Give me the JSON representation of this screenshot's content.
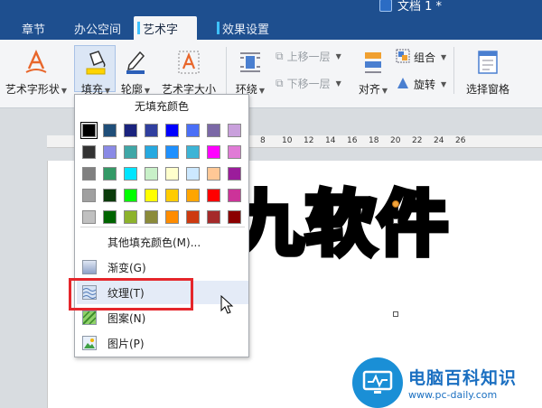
{
  "window": {
    "title": "文档 1 *"
  },
  "tabs": [
    {
      "label": "章节"
    },
    {
      "label": "办公空间"
    },
    {
      "label": "艺术字"
    },
    {
      "label": "效果设置"
    }
  ],
  "ribbon": {
    "art_shape": "艺术字形状",
    "fill": "填充",
    "outline": "轮廓",
    "art_size": "艺术字大小",
    "wrap": "环绕",
    "bring_forward": "上移一层",
    "send_backward": "下移一层",
    "align": "对齐",
    "group": "组合",
    "rotate": "旋转",
    "selection_pane": "选择窗格"
  },
  "ruler": {
    "ticks": [
      "8",
      "10",
      "12",
      "14",
      "16",
      "18",
      "20",
      "22",
      "24",
      "26"
    ]
  },
  "document": {
    "art_text": "九软件"
  },
  "fill_menu": {
    "no_fill": "无填充颜色",
    "more_colors": "其他填充颜色(M)...",
    "items": [
      {
        "label": "渐变(G)",
        "icon": "gradient-icon"
      },
      {
        "label": "纹理(T)",
        "icon": "texture-icon"
      },
      {
        "label": "图案(N)",
        "icon": "pattern-icon"
      },
      {
        "label": "图片(P)",
        "icon": "picture-icon"
      }
    ],
    "palette": [
      [
        "#000000",
        "#1f4e79",
        "#1a237e",
        "#303f9f",
        "#0000ff",
        "#4a6ff7",
        "#7b68a6",
        "#c9a0dc"
      ],
      [
        "#333333",
        "#8a8ae6",
        "#3fa7a7",
        "#26a9e0",
        "#1e90ff",
        "#3cb4d6",
        "#ff00ff",
        "#e07bd6"
      ],
      [
        "#808080",
        "#339966",
        "#00e5ff",
        "#c8f0c8",
        "#ffffcc",
        "#cce8ff",
        "#ffc896",
        "#9b1c9b"
      ],
      [
        "#a0a0a0",
        "#0b3b0b",
        "#00ff00",
        "#ffff00",
        "#ffcc00",
        "#ffa500",
        "#ff0000",
        "#cc3399"
      ],
      [
        "#c0c0c0",
        "#006400",
        "#8db32c",
        "#8b8b3a",
        "#ff8c00",
        "#cd3a10",
        "#a52a2a",
        "#8b0000"
      ]
    ]
  },
  "watermark": {
    "line1": "电脑百科知识",
    "line2": "www.pc-daily.com"
  },
  "colors": {
    "accent": "#1e4f8f",
    "highlight_red": "#e5262b"
  }
}
